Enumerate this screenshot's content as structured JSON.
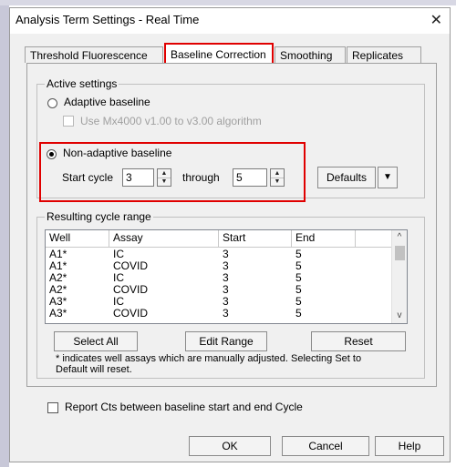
{
  "window": {
    "title": "Analysis Term Settings - Real Time",
    "close_glyph": "✕"
  },
  "tabs": [
    {
      "label": "Threshold Fluorescence",
      "active": false
    },
    {
      "label": "Baseline Correction",
      "active": true
    },
    {
      "label": "Smoothing",
      "active": false
    },
    {
      "label": "Replicates",
      "active": false
    }
  ],
  "active_settings": {
    "legend": "Active settings",
    "adaptive_label": "Adaptive baseline",
    "adaptive_selected": false,
    "mx4000_label": "Use Mx4000 v1.00 to v3.00 algorithm",
    "mx4000_checked": false,
    "mx4000_enabled": false,
    "non_adaptive_label": "Non-adaptive baseline",
    "non_adaptive_selected": true,
    "start_cycle_label": "Start cycle",
    "start_cycle_value": "3",
    "through_label": "through",
    "through_value": "5",
    "defaults_label": "Defaults",
    "defaults_arrow": "▼"
  },
  "cycle_range": {
    "legend": "Resulting cycle range",
    "columns": [
      "Well",
      "Assay",
      "Start",
      "End"
    ],
    "rows": [
      [
        "A1*",
        "IC",
        "3",
        "5"
      ],
      [
        "A1*",
        "COVID",
        "3",
        "5"
      ],
      [
        "A2*",
        "IC",
        "3",
        "5"
      ],
      [
        "A2*",
        "COVID",
        "3",
        "5"
      ],
      [
        "A3*",
        "IC",
        "3",
        "5"
      ],
      [
        "A3*",
        "COVID",
        "3",
        "5"
      ]
    ],
    "select_all_label": "Select All",
    "edit_range_label": "Edit Range",
    "reset_label": "Reset",
    "note": "* indicates well assays which are manually adjusted. Selecting Set to Default will reset."
  },
  "report_cts": {
    "label": "Report Cts between baseline start and end Cycle",
    "checked": false
  },
  "footer": {
    "ok_label": "OK",
    "cancel_label": "Cancel",
    "help_label": "Help"
  },
  "colors": {
    "highlight": "#e00000",
    "dialog_bg": "#f0f0f0"
  }
}
